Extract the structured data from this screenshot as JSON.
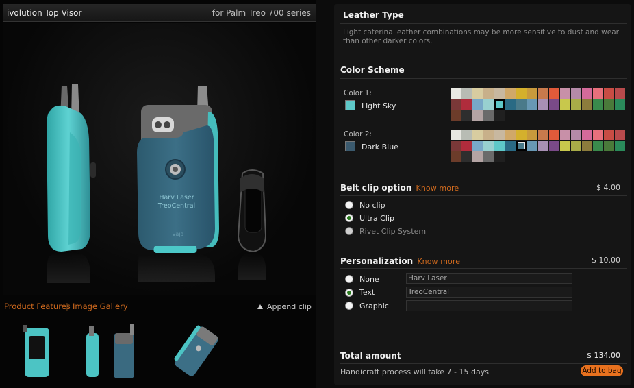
{
  "header": {
    "product_title": "ivolution Top Visor",
    "product_subtitle": "for Palm Treo 700 series"
  },
  "preview": {
    "engraving_line1": "Harv Laser",
    "engraving_line2": "TreoCentral",
    "brand_mark": "vaja"
  },
  "gallery": {
    "links": [
      "Product Features",
      "Image Gallery"
    ],
    "separator": "|",
    "append_label": "Append clip"
  },
  "leather": {
    "title": "Leather Type",
    "description": "Light caterina leather combinations may be more sensitive to dust and wear than other darker colors."
  },
  "colors": {
    "title": "Color Scheme",
    "color1_label": "Color 1:",
    "color1_name": "Light Sky",
    "color1_hex": "#5ec8c8",
    "color2_label": "Color 2:",
    "color2_name": "Dark Blue",
    "color2_hex": "#3b5a6e",
    "palette": [
      "#e8e8e2",
      "#b8bcb4",
      "#d8cca0",
      "#c8b08a",
      "#c8b8a0",
      "#d0a868",
      "#d4b02c",
      "#c89a3c",
      "#c87a4c",
      "#e05a3a",
      "#c890a8",
      "#b48aa8",
      "#d46a9a",
      "#e8707c",
      "#c84c44",
      "#b84a4c",
      "#7a3838",
      "#b02c3c",
      "#78a8c8",
      "#98d0d0",
      "#5ec8c8",
      "#2a6a84",
      "#4a7a8a",
      "#6898b4",
      "#a890b4",
      "#7a4a88",
      "#c8c84c",
      "#a8ac48",
      "#8c7c3c",
      "#3a8a4c",
      "#4a7a3a",
      "#2a8a5a",
      "#6c3c2a",
      "#2e2e2e",
      "#b4a4a4",
      "#6a6a6a",
      "#202020"
    ],
    "color1_selected_index": 20,
    "color2_selected_index": 22
  },
  "belt_clip": {
    "title": "Belt clip option",
    "know_more": "Know more",
    "price": "$   4.00",
    "options": [
      {
        "label": "No clip",
        "selected": false,
        "disabled": false
      },
      {
        "label": "Ultra Clip",
        "selected": true,
        "disabled": false
      },
      {
        "label": "Rivet Clip System",
        "selected": false,
        "disabled": true
      }
    ]
  },
  "personalization": {
    "title": "Personalization",
    "know_more": "Know more",
    "price": "$  10.00",
    "options": [
      {
        "label": "None",
        "selected": false
      },
      {
        "label": "Text",
        "selected": true
      },
      {
        "label": "Graphic",
        "selected": false
      }
    ],
    "inputs": [
      "Harv Laser",
      "TreoCentral",
      ""
    ]
  },
  "total": {
    "label": "Total amount",
    "value": "$  134.00",
    "process_text": "Handicraft process will take  7 - 15 days",
    "add_button": "Add to bag"
  }
}
